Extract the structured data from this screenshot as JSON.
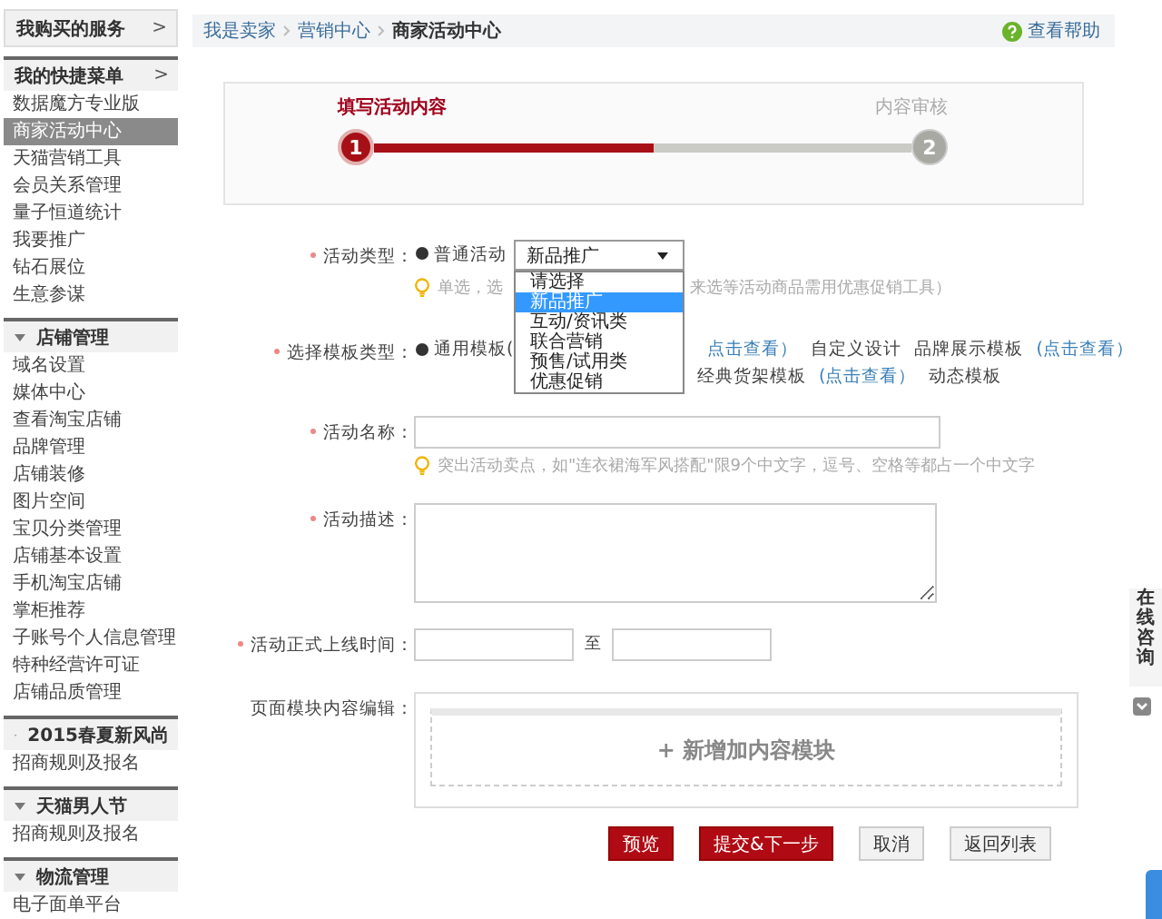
{
  "sidebar": {
    "sections": [
      {
        "kind": "menu",
        "title": "我购买的服务",
        "arrow": ">"
      },
      {
        "kind": "menu",
        "title": "我的快捷菜单",
        "arrow": ">",
        "items": [
          {
            "label": "数据魔方专业版",
            "selected": false
          },
          {
            "label": "商家活动中心",
            "selected": true
          },
          {
            "label": "天猫营销工具",
            "selected": false
          },
          {
            "label": "会员关系管理",
            "selected": false
          },
          {
            "label": "量子恒道统计",
            "selected": false
          },
          {
            "label": "我要推广",
            "selected": false
          },
          {
            "label": "钻石展位",
            "selected": false
          },
          {
            "label": "生意参谋",
            "selected": false
          }
        ]
      },
      {
        "kind": "group",
        "title": "店铺管理",
        "items": [
          {
            "label": "域名设置",
            "selected": false
          },
          {
            "label": "媒体中心",
            "selected": false
          },
          {
            "label": "查看淘宝店铺",
            "selected": false
          },
          {
            "label": "品牌管理",
            "selected": false
          },
          {
            "label": "店铺装修",
            "selected": false
          },
          {
            "label": "图片空间",
            "selected": false
          },
          {
            "label": "宝贝分类管理",
            "selected": false
          },
          {
            "label": "店铺基本设置",
            "selected": false
          },
          {
            "label": "手机淘宝店铺",
            "selected": false
          },
          {
            "label": "掌柜推荐",
            "selected": false
          },
          {
            "label": "子账号个人信息管理",
            "selected": false
          },
          {
            "label": "特种经营许可证",
            "selected": false
          },
          {
            "label": "店铺品质管理",
            "selected": false
          }
        ]
      },
      {
        "kind": "group",
        "title": "2015春夏新风尚",
        "items": [
          {
            "label": "招商规则及报名",
            "selected": false
          }
        ]
      },
      {
        "kind": "group",
        "title": "天猫男人节",
        "items": [
          {
            "label": "招商规则及报名",
            "selected": false
          }
        ]
      },
      {
        "kind": "group",
        "title": "物流管理",
        "items": [
          {
            "label": "电子面单平台",
            "selected": false
          }
        ]
      }
    ]
  },
  "breadcrumb": [
    {
      "label": "我是卖家",
      "current": false
    },
    {
      "label": "营销中心",
      "current": false
    },
    {
      "label": "商家活动中心",
      "current": true
    }
  ],
  "help": "查看帮助",
  "steps": {
    "level": 0.52,
    "items": [
      {
        "number": "1",
        "label": "填写活动内容",
        "active": true
      },
      {
        "number": "2",
        "label": "内容审核",
        "active": false
      }
    ]
  },
  "form": [
    {
      "kind": "type",
      "label": "活动类型：",
      "required": true,
      "radio": {
        "label": "普通活动",
        "checked": true
      },
      "select": {
        "value": "新品推广",
        "options": [
          {
            "label": "请选择",
            "selected": false
          },
          {
            "label": "新品推广",
            "selected": true
          },
          {
            "label": "互动/资讯类",
            "selected": false
          },
          {
            "label": "联合营销",
            "selected": false
          },
          {
            "label": "预售/试用类",
            "selected": false
          },
          {
            "label": "优惠促销",
            "selected": false
          }
        ]
      },
      "hint": [
        "单选，选",
        "来选等活动商品需用优惠促销工具）"
      ]
    },
    {
      "kind": "template",
      "label": "选择模板类型：",
      "required": true,
      "lines": [
        [
          {
            "text": "通用模板(",
            "link": false,
            "radio": true,
            "checked": true
          },
          {
            "text": "点击查看）",
            "link": true
          },
          {
            "text": "自定义设计",
            "link": false
          },
          {
            "text": "品牌展示模板",
            "link": false
          },
          {
            "text": "(点击查看）",
            "link": true
          }
        ],
        [
          {
            "text": "经典货架模板",
            "link": false
          },
          {
            "text": "(点击查看）",
            "link": true
          },
          {
            "text": "动态模板",
            "link": false
          }
        ]
      ]
    },
    {
      "kind": "text",
      "label": "活动名称：",
      "required": true,
      "hint": "突出活动卖点，如\"连衣裙海军风搭配\"限9个中文字，逗号、空格等都占一个中文字"
    },
    {
      "kind": "textarea",
      "label": "活动描述：",
      "required": true
    },
    {
      "kind": "daterange",
      "label": "活动正式上线时间：",
      "required": true,
      "separator": "至"
    },
    {
      "kind": "modules",
      "label": "页面模块内容编辑：",
      "required": false,
      "add": "+ 新增加内容模块"
    }
  ],
  "buttons": [
    {
      "label": "预览",
      "primary": true
    },
    {
      "label": "提交&下一步",
      "primary": true
    },
    {
      "label": "取消",
      "primary": false
    },
    {
      "label": "返回列表",
      "primary": false
    }
  ],
  "consult": "在线咨询"
}
